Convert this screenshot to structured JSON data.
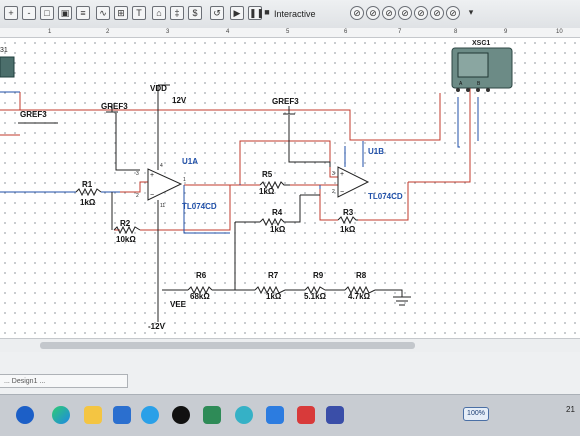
{
  "toolbar": {
    "mode_label": "Interactive",
    "icons": [
      "zoom-in-icon",
      "zoom-out-icon",
      "zoom-area-icon",
      "zoom-fit-icon",
      "fullscreen-icon",
      "play-icon",
      "pause-icon",
      "stop-icon",
      "probe-icon"
    ]
  },
  "ruler": {
    "marks": [
      "1",
      "2",
      "3",
      "4",
      "5",
      "6",
      "7",
      "8",
      "9",
      "10"
    ]
  },
  "schematic": {
    "left_instrument_label": "31",
    "scope_label": "XSC1",
    "gref_left": "GREF3",
    "gref_u1a": "GREF3",
    "gref_u1b": "GREF3",
    "vdd_label": "VDD",
    "vdd_value": "12V",
    "vee_label": "VEE",
    "vee_value": "-12V",
    "u1a": {
      "name": "U1A",
      "part": "TL074CD"
    },
    "u1b": {
      "name": "U1B",
      "part": "TL074CD"
    },
    "pin_3": "3",
    "pin_2": "2",
    "pin_4": "4",
    "pin_11": "11",
    "pin_1": "1",
    "r1": {
      "name": "R1",
      "value": "1kΩ"
    },
    "r2": {
      "name": "R2",
      "value": "10kΩ"
    },
    "r3": {
      "name": "R3",
      "value": "1kΩ"
    },
    "r4": {
      "name": "R4",
      "value": "1kΩ"
    },
    "r5": {
      "name": "R5",
      "value": "1kΩ"
    },
    "r6": {
      "name": "R6",
      "value": "68kΩ"
    },
    "r7": {
      "name": "R7",
      "value": "1kΩ"
    },
    "r8": {
      "name": "R8",
      "value": "4.7kΩ"
    },
    "r9": {
      "name": "R9",
      "value": "5.1kΩ"
    },
    "scope_channels": [
      "A",
      "B"
    ]
  },
  "sheet_tab": "... Design1 ...",
  "taskbar": {
    "apps": [
      "windows-start",
      "edge-browser",
      "file-explorer",
      "mail",
      "copilot",
      "qq",
      "spreadsheet",
      "android-app",
      "k-app",
      "wps-app",
      "calculator"
    ],
    "zoom_label": "100%",
    "clock": "21"
  }
}
